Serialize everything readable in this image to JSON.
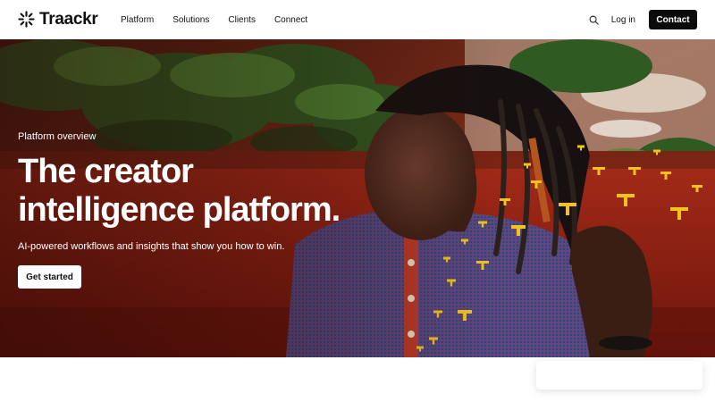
{
  "brand": {
    "name": "Traackr",
    "logo_icon": "traackr-logo-icon"
  },
  "nav": {
    "items": [
      {
        "label": "Platform"
      },
      {
        "label": "Solutions"
      },
      {
        "label": "Clients"
      },
      {
        "label": "Connect"
      }
    ]
  },
  "header": {
    "search_icon": "search-icon",
    "login_label": "Log in",
    "contact_label": "Contact"
  },
  "hero": {
    "eyebrow": "Platform overview",
    "title_line1": "The creator",
    "title_line2": "intelligence platform.",
    "subtitle": "AI-powered workflows and insights that show you how to win.",
    "cta_label": "Get started"
  },
  "colors": {
    "accent": "#f4c21c",
    "cta_dark": "#0b0b0b",
    "hero_red": "#8e2314"
  }
}
